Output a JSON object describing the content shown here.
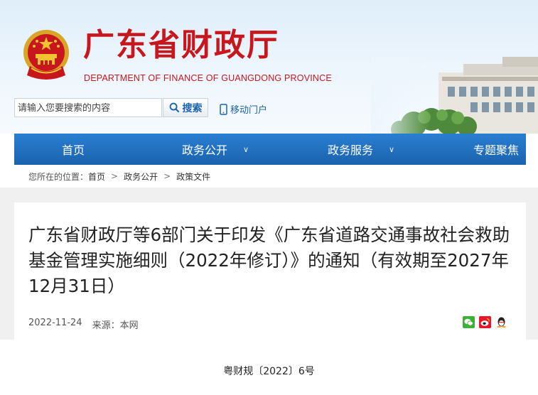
{
  "site": {
    "title": "广东省财政厅",
    "subtitle": "DEPARTMENT OF FINANCE OF GUANGDONG PROVINCE"
  },
  "search": {
    "placeholder": "请输入您要搜索的内容",
    "button_label": "搜索"
  },
  "mobile_portal": "移动门户",
  "nav": {
    "items": [
      {
        "label": "首页"
      },
      {
        "label": "政务公开"
      },
      {
        "label": "政务服务"
      },
      {
        "label": "专题聚焦"
      }
    ]
  },
  "breadcrumb": {
    "label": "您所在的位置：",
    "items": [
      "首页",
      "政务公开",
      "政策文件"
    ],
    "separator": ">"
  },
  "article": {
    "title": "广东省财政厅等6部门关于印发《广东省道路交通事故社会救助基金管理实施细则（2022年修订）》的通知（有效期至2027年12月31日）",
    "date": "2022-11-24",
    "source": "来源：本网",
    "doc_number": "粤财规〔2022〕6号"
  },
  "colors": {
    "brand_red": "#c8161d",
    "nav_blue": "#1b62ad",
    "link_blue": "#1b62ad"
  }
}
